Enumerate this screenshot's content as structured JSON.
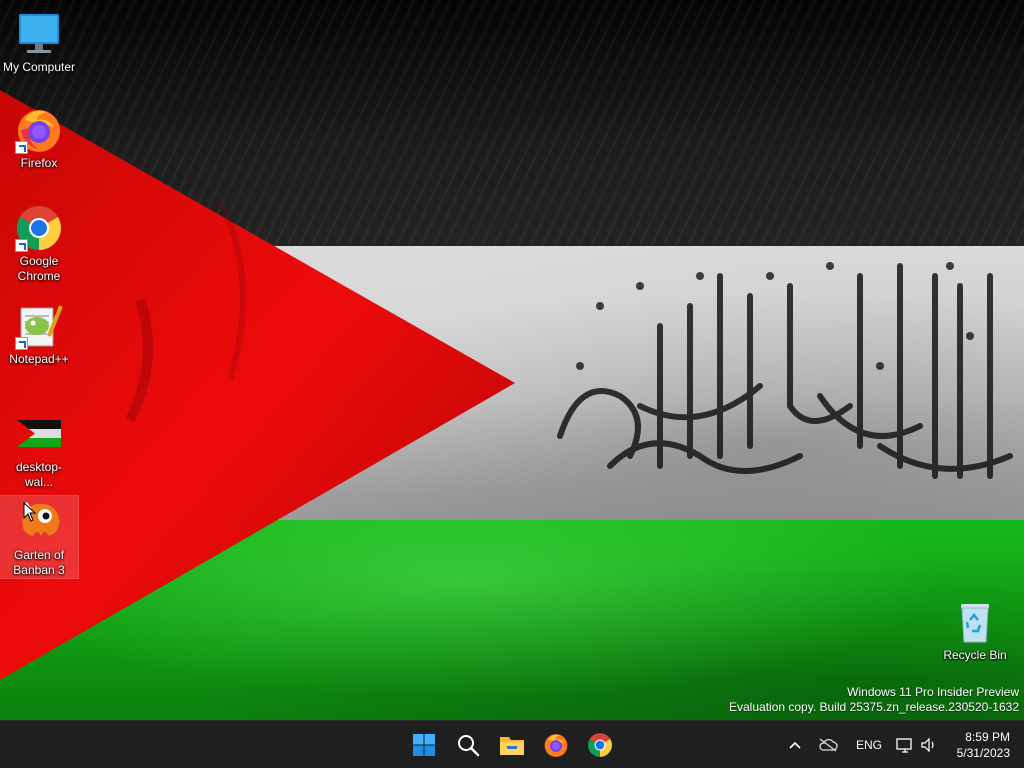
{
  "desktop": {
    "icons": [
      {
        "label": "My Computer",
        "icon": "monitor-icon"
      },
      {
        "label": "Firefox",
        "icon": "firefox-icon"
      },
      {
        "label": "Google Chrome",
        "icon": "chrome-icon"
      },
      {
        "label": "Notepad++",
        "icon": "notepadpp-icon"
      },
      {
        "label": "desktop-wal...",
        "icon": "image-file-icon"
      },
      {
        "label": "Garten of Banban 3",
        "icon": "banban-game-icon"
      },
      {
        "label": "Recycle Bin",
        "icon": "recycle-bin-icon"
      }
    ],
    "wallpaper": "palestinian-flag-with-calligraphy",
    "colors": {
      "red": "#e30a0a",
      "green": "#16b01a",
      "white": "#d4d4d4",
      "black": "#111111"
    }
  },
  "watermark": {
    "line1": "Windows 11 Pro Insider Preview",
    "line2": "Evaluation copy. Build 25375.zn_release.230520-1632"
  },
  "taskbar": {
    "apps": [
      {
        "name": "start-button",
        "icon": "windows-logo-icon"
      },
      {
        "name": "search-button",
        "icon": "search-icon"
      },
      {
        "name": "file-explorer-button",
        "icon": "folder-icon"
      },
      {
        "name": "firefox-taskbar-button",
        "icon": "firefox-icon"
      },
      {
        "name": "chrome-taskbar-button",
        "icon": "chrome-icon"
      }
    ],
    "tray": {
      "language": "ENG",
      "time": "8:59 PM",
      "date": "5/31/2023"
    }
  }
}
